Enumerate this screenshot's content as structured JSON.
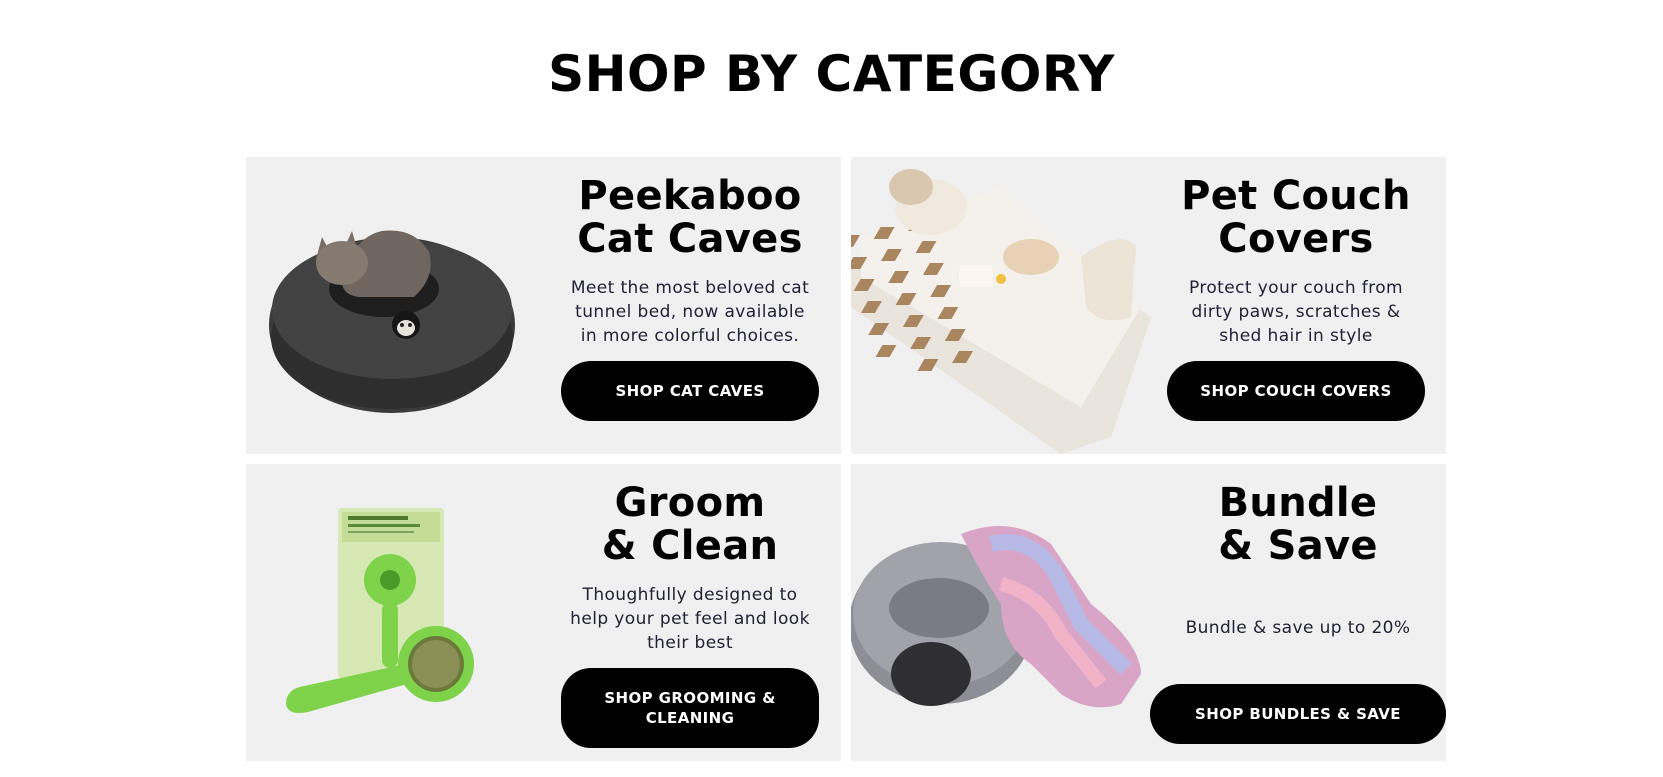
{
  "section": {
    "title": "SHOP BY CATEGORY"
  },
  "cards": [
    {
      "title_line1": "Peekaboo",
      "title_line2": "Cat Caves",
      "description": "Meet the most beloved cat tunnel bed, now available in more colorful choices.",
      "button_label": "SHOP CAT CAVES",
      "image": "cat-cave-photo"
    },
    {
      "title_line1": "Pet Couch",
      "title_line2": "Covers",
      "description": "Protect your couch from dirty paws, scratches & shed hair in style",
      "button_label": "SHOP COUCH COVERS",
      "image": "couch-cover-photo"
    },
    {
      "title_line1": "Groom",
      "title_line2": "& Clean",
      "description": "Thoughfully designed to help your pet feel and look their best",
      "button_label": "SHOP GROOMING & CLEANING",
      "image": "grooming-brush-photo"
    },
    {
      "title_line1": "Bundle",
      "title_line2": "& Save",
      "description": "Bundle & save up to 20%",
      "button_label": "SHOP BUNDLES & SAVE",
      "image": "bundle-cave-blanket-photo"
    }
  ],
  "colors": {
    "card_bg": "#f0f0f0",
    "button_bg": "#000000",
    "button_text": "#ffffff",
    "body_text": "#1f2033"
  }
}
